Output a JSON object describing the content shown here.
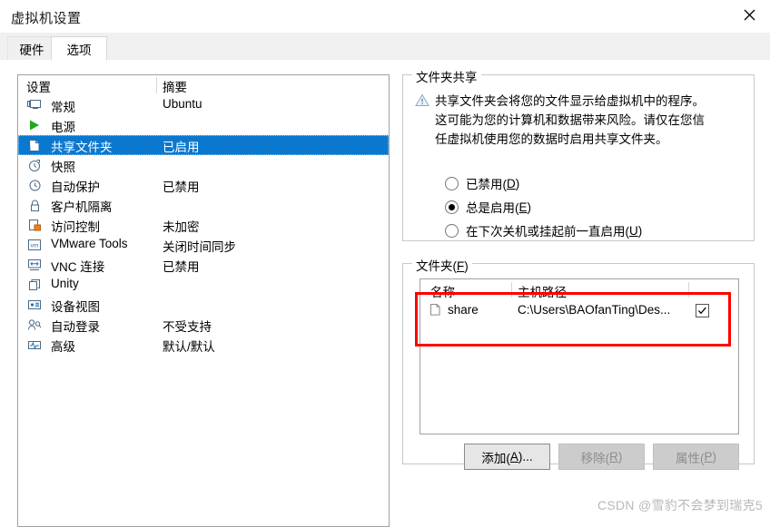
{
  "window": {
    "title": "虚拟机设置",
    "close_icon": "close-icon"
  },
  "tabs": [
    {
      "label": "硬件",
      "active": false
    },
    {
      "label": "选项",
      "active": true
    }
  ],
  "settings_list": {
    "columns": [
      "设置",
      "摘要"
    ],
    "rows": [
      {
        "icon": "monitor-icon",
        "label": "常规",
        "summary": "Ubuntu",
        "selected": false
      },
      {
        "icon": "power-play-icon",
        "label": "电源",
        "summary": "",
        "selected": false
      },
      {
        "icon": "shared-folder-icon",
        "label": "共享文件夹",
        "summary": "已启用",
        "selected": true
      },
      {
        "icon": "snapshot-clock-icon",
        "label": "快照",
        "summary": "",
        "selected": false
      },
      {
        "icon": "autoprotect-icon",
        "label": "自动保护",
        "summary": "已禁用",
        "selected": false
      },
      {
        "icon": "lock-icon",
        "label": "客户机隔离",
        "summary": "",
        "selected": false
      },
      {
        "icon": "access-control-icon",
        "label": "访问控制",
        "summary": "未加密",
        "selected": false
      },
      {
        "icon": "vmware-tools-icon",
        "label": "VMware Tools",
        "summary": "关闭时间同步",
        "selected": false
      },
      {
        "icon": "vnc-icon",
        "label": "VNC 连接",
        "summary": "已禁用",
        "selected": false
      },
      {
        "icon": "unity-icon",
        "label": "Unity",
        "summary": "",
        "selected": false
      },
      {
        "icon": "device-view-icon",
        "label": "设备视图",
        "summary": "",
        "selected": false
      },
      {
        "icon": "auto-login-icon",
        "label": "自动登录",
        "summary": "不受支持",
        "selected": false
      },
      {
        "icon": "advanced-icon",
        "label": "高级",
        "summary": "默认/默认",
        "selected": false
      }
    ]
  },
  "folder_sharing": {
    "title": "文件夹共享",
    "warning_icon": "warning-triangle-icon",
    "warning_text": "共享文件夹会将您的文件显示给虚拟机中的程序。这可能为您的计算机和数据带来风险。请仅在您信任虚拟机使用您的数据时启用共享文件夹。",
    "options": [
      {
        "label": "已禁用(",
        "accel": "D",
        "suffix": ")",
        "checked": false
      },
      {
        "label": "总是启用(",
        "accel": "E",
        "suffix": ")",
        "checked": true
      },
      {
        "label": "在下次关机或挂起前一直启用(",
        "accel": "U",
        "suffix": ")",
        "checked": false
      }
    ]
  },
  "folders": {
    "title_prefix": "文件夹(",
    "title_accel": "F",
    "title_suffix": ")",
    "columns": [
      "名称",
      "主机路径"
    ],
    "rows": [
      {
        "icon": "folder-icon",
        "name": "share",
        "host_path": "C:\\Users\\BAOfanTing\\Des...",
        "enabled": true
      }
    ],
    "buttons": [
      {
        "label_prefix": "添加(",
        "accel": "A",
        "label_suffix": ")...",
        "disabled": false
      },
      {
        "label_prefix": "移除(",
        "accel": "R",
        "label_suffix": ")",
        "disabled": true
      },
      {
        "label_prefix": "属性(",
        "accel": "P",
        "label_suffix": ")",
        "disabled": true
      }
    ]
  },
  "watermark": "CSDN @雪豹不会梦到瑞克5",
  "colors": {
    "selection_blue": "#0b78d0",
    "highlight_red": "#ff0000",
    "power_green": "#1faa1f",
    "accent_orange": "#f0801a"
  }
}
